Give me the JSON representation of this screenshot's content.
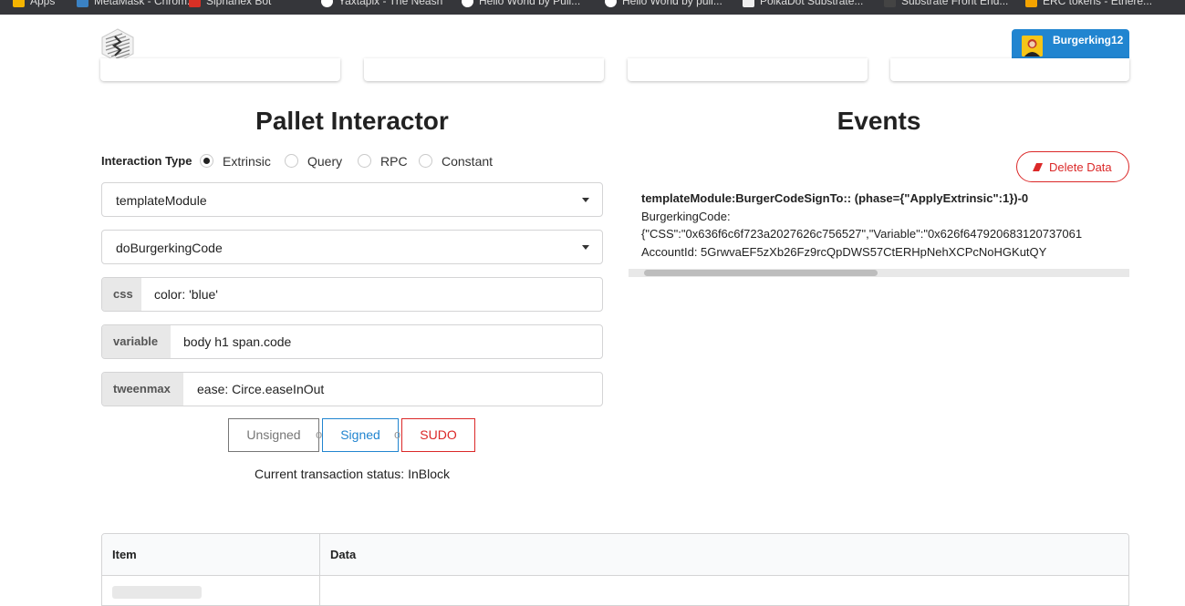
{
  "bookmarks_bar": [
    {
      "label": "Apps",
      "icon": "apps-grid-icon"
    },
    {
      "label": "MetaMask - Chrom...",
      "icon": "metamask-icon"
    },
    {
      "label": "Siphahex Bot",
      "icon": "bot-icon"
    },
    {
      "label": "Yaxtapix - The Neash",
      "icon": "site-icon"
    },
    {
      "label": "Hello World by Pull...",
      "icon": "site-icon"
    },
    {
      "label": "Hello World by pull...",
      "icon": "site-icon"
    },
    {
      "label": "PolkaDot Substrate...",
      "icon": "polkadot-icon"
    },
    {
      "label": "Substrate Front End...",
      "icon": "substrate-icon"
    },
    {
      "label": "ERC tokens - Ethere...",
      "icon": "ethereum-icon"
    }
  ],
  "header": {
    "logo_icon": "substrate-logo-icon",
    "account": {
      "name": "Burgerking12",
      "avatar_icon": "user-avatar-icon",
      "color": "#2185d0"
    }
  },
  "pallet_interactor": {
    "title": "Pallet Interactor",
    "interaction_type_label": "Interaction Type",
    "interaction_types": [
      {
        "label": "Extrinsic",
        "selected": true
      },
      {
        "label": "Query",
        "selected": false
      },
      {
        "label": "RPC",
        "selected": false
      },
      {
        "label": "Constant",
        "selected": false
      }
    ],
    "pallet_select": "templateModule",
    "callable_select": "doBurgerkingCode",
    "params": [
      {
        "label": "css",
        "value": "color: 'blue'"
      },
      {
        "label": "variable",
        "value": "body h1 span.code"
      },
      {
        "label": "tweenmax",
        "value": "ease: Circe.easeInOut"
      }
    ],
    "buttons": {
      "unsigned": "Unsigned",
      "or": "or",
      "signed": "Signed",
      "sudo": "SUDO"
    },
    "status": "Current transaction status: InBlock"
  },
  "events": {
    "title": "Events",
    "delete_label": "Delete Data",
    "delete_icon": "eraser-icon",
    "items": [
      {
        "title": "templateModule:BurgerCodeSignTo:: (phase={\"ApplyExtrinsic\":1})-0",
        "lines": [
          "BurgerkingCode:",
          "{\"CSS\":\"0x636f6c6f723a2027626c756527\",\"Variable\":\"0x626f647920683120737061",
          "AccountId: 5GrwvaEF5zXb26Fz9rcQpDWS57CtERHpNehXCPcNoHGKutQY"
        ]
      }
    ]
  },
  "table": {
    "columns": [
      "Item",
      "Data"
    ]
  },
  "colors": {
    "primary": "#2185d0",
    "danger": "#db2828",
    "accent_blue": "#2185d0"
  }
}
